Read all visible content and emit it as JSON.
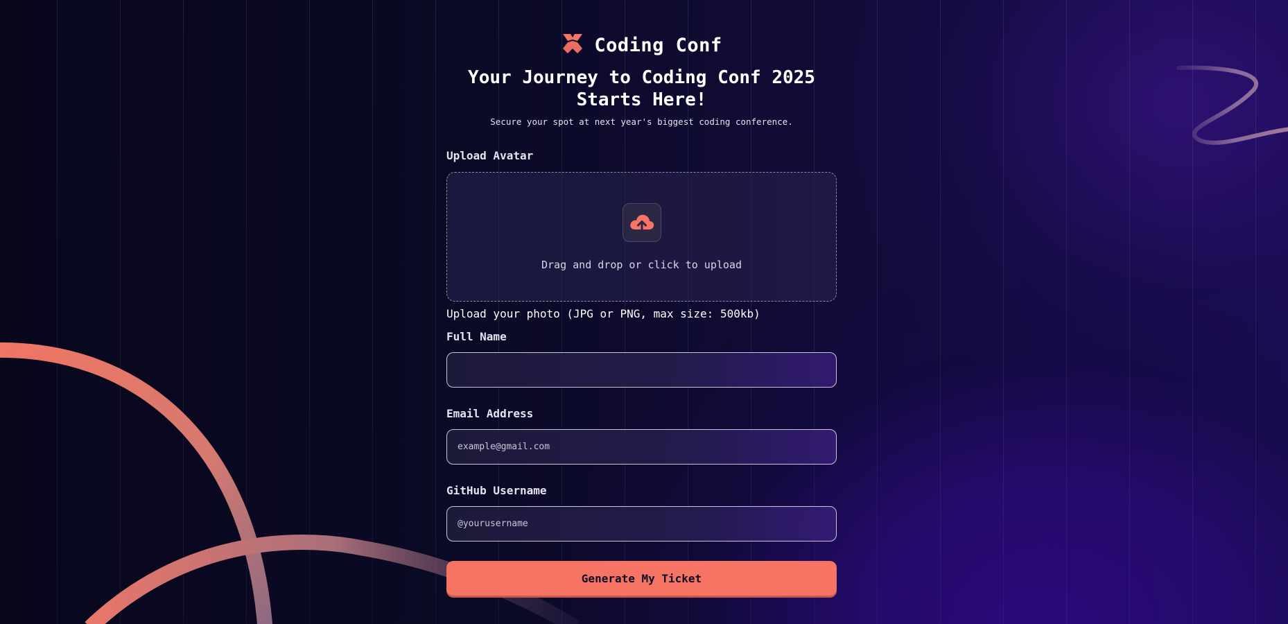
{
  "brand": {
    "name": "Coding Conf",
    "logo_icon": "coding-conf-logo-icon"
  },
  "hero": {
    "title": "Your Journey to Coding Conf 2025 Starts Here!",
    "subtitle": "Secure your spot at next year's biggest coding conference."
  },
  "form": {
    "avatar": {
      "label": "Upload Avatar",
      "dropzone_text": "Drag and drop or click to upload",
      "icon": "cloud-upload-icon",
      "hint": "Upload your photo (JPG or PNG, max size: 500kb)"
    },
    "full_name": {
      "label": "Full Name",
      "value": ""
    },
    "email": {
      "label": "Email Address",
      "placeholder": "example@gmail.com"
    },
    "github": {
      "label": "GitHub Username",
      "placeholder": "@yourusername"
    },
    "submit_label": "Generate My Ticket"
  },
  "colors": {
    "accent": "#f57463",
    "background": "#0d0b26",
    "glow": "#2a0a7a"
  }
}
